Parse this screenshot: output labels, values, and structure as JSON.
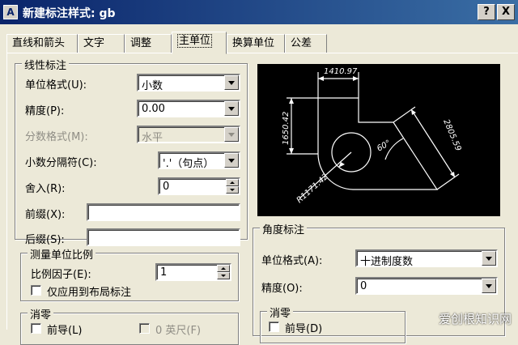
{
  "window": {
    "title": "新建标注样式: gb",
    "help_label": "?",
    "close_label": "X"
  },
  "tabs": [
    {
      "label": "直线和箭头"
    },
    {
      "label": "文字"
    },
    {
      "label": "调整"
    },
    {
      "label": "主单位",
      "active": true
    },
    {
      "label": "换算单位"
    },
    {
      "label": "公差"
    }
  ],
  "linear": {
    "title": "线性标注",
    "unit_format": {
      "label": "单位格式(U):",
      "value": "小数"
    },
    "precision": {
      "label": "精度(P):",
      "value": "0.00"
    },
    "fraction_format": {
      "label": "分数格式(M):",
      "value": "水平",
      "disabled": true
    },
    "decimal_separator": {
      "label": "小数分隔符(C):",
      "value": "'.'（句点）"
    },
    "round_off": {
      "label": "舍入(R):",
      "value": "0"
    },
    "prefix": {
      "label": "前缀(X):",
      "value": ""
    },
    "suffix": {
      "label": "后缀(S):",
      "value": ""
    }
  },
  "scale": {
    "title": "测量单位比例",
    "factor": {
      "label": "比例因子(E):",
      "value": "1"
    },
    "layout_only": {
      "label": "仅应用到布局标注",
      "checked": false
    }
  },
  "zero_linear": {
    "title": "消零",
    "leading": {
      "label": "前导(L)"
    },
    "feet": {
      "label": "0 英尺(F)",
      "disabled": true
    }
  },
  "preview": {
    "dim_top": "1410.97",
    "dim_left": "1650.42",
    "dim_right": "2805.59",
    "dim_angle": "60°",
    "dim_radius": "R1171.42"
  },
  "angular": {
    "title": "角度标注",
    "unit_format": {
      "label": "单位格式(A):",
      "value": "十进制度数"
    },
    "precision": {
      "label": "精度(O):",
      "value": "0"
    },
    "zero": {
      "title": "消零",
      "leading": {
        "label": "前导(D)"
      }
    }
  },
  "watermark": "爱创根知识网",
  "colors": {
    "title_start": "#0a246a",
    "title_end": "#3a6ea5",
    "face": "#ece9d8"
  }
}
